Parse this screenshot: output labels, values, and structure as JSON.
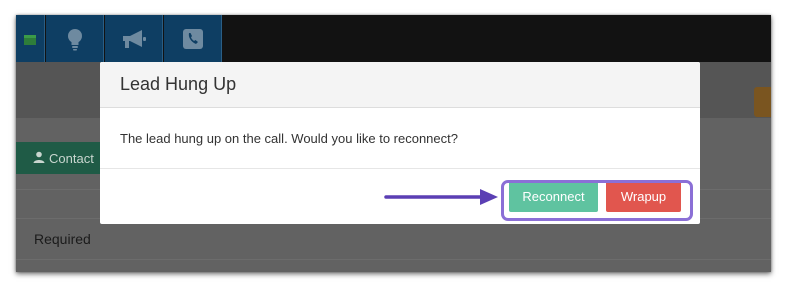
{
  "topbar": {
    "items": [
      {
        "icon": "calendar-icon"
      },
      {
        "icon": "lightbulb-icon"
      },
      {
        "icon": "megaphone-icon"
      },
      {
        "icon": "phone-icon"
      }
    ]
  },
  "page": {
    "contact_tab_label": "Contact",
    "required_label": "Required"
  },
  "modal": {
    "title": "Lead Hung Up",
    "message": "The lead hung up on the call. Would you like to reconnect?",
    "reconnect_label": "Reconnect",
    "wrapup_label": "Wrapup"
  },
  "colors": {
    "topbar_button": "#0e3e63",
    "reconnect": "#5fc3a0",
    "wrapup": "#e1564e",
    "annotation": "#8b6fd6",
    "arrow": "#5b3fb4"
  }
}
